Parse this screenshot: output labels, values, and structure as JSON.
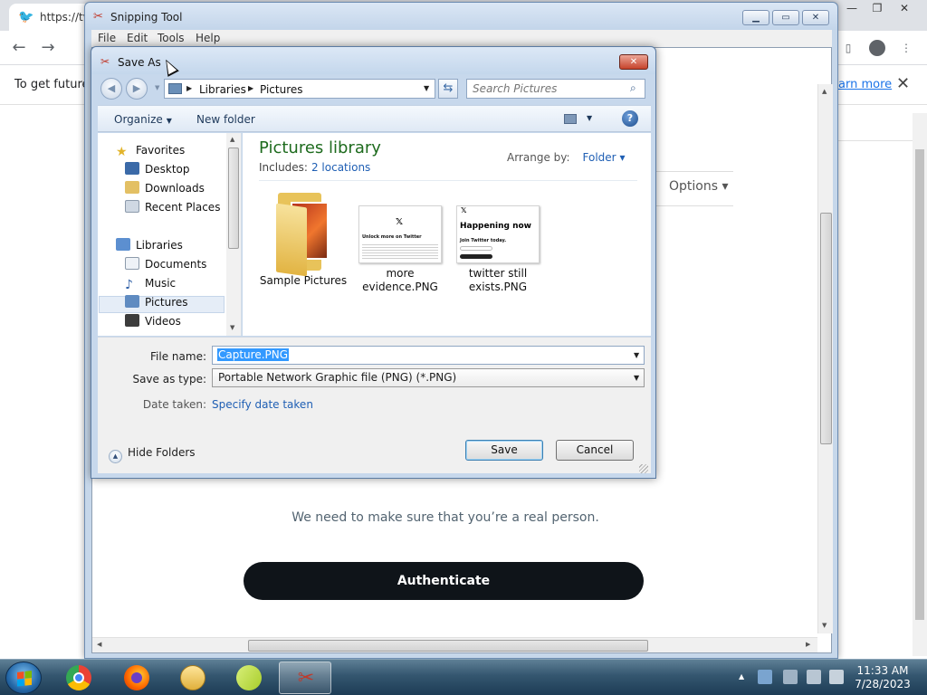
{
  "chrome": {
    "tab_title": "https://tv",
    "info_text": "To get future",
    "learn_more": "arn more"
  },
  "snip": {
    "title": "Snipping Tool",
    "menu": [
      "File",
      "Edit",
      "Tools",
      "Help"
    ],
    "captured": {
      "options_label": "Options",
      "message": "We need to make sure that you’re a real person.",
      "auth_button": "Authenticate"
    }
  },
  "dialog": {
    "title": "Save As",
    "breadcrumb": [
      "Libraries",
      "Pictures"
    ],
    "search_placeholder": "Search Pictures",
    "organize": "Organize",
    "new_folder": "New folder",
    "nav": {
      "favorites": "Favorites",
      "favorites_items": [
        "Desktop",
        "Downloads",
        "Recent Places"
      ],
      "libraries": "Libraries",
      "libraries_items": [
        "Documents",
        "Music",
        "Pictures",
        "Videos"
      ],
      "selected": "Pictures"
    },
    "library": {
      "title": "Pictures library",
      "includes_label": "Includes:",
      "includes_link": "2 locations",
      "arrange_label": "Arrange by:",
      "arrange_value": "Folder"
    },
    "files": [
      {
        "name": "Sample Pictures"
      },
      {
        "name": "more evidence.PNG",
        "line1": "more",
        "line2": "evidence.PNG",
        "thumb_text": "Unlock more on Twitter"
      },
      {
        "name": "twitter still exists.PNG",
        "line1": "twitter still",
        "line2": "exists.PNG",
        "thumb_title": "Happening now",
        "thumb_sub": "Join Twitter today."
      }
    ],
    "form": {
      "file_name_label": "File name:",
      "file_name_value": "Capture.PNG",
      "save_type_label": "Save as type:",
      "save_type_value": "Portable Network Graphic file (PNG) (*.PNG)",
      "date_label": "Date taken:",
      "date_link": "Specify date taken",
      "hide_folders": "Hide Folders",
      "save": "Save",
      "cancel": "Cancel"
    }
  },
  "taskbar": {
    "apps": [
      "Google Chrome",
      "Firefox",
      "Windows Explorer",
      "Sticky Notes",
      "Snipping Tool"
    ],
    "active_app": "Snipping Tool",
    "time": "11:33 AM",
    "date": "7/28/2023"
  }
}
